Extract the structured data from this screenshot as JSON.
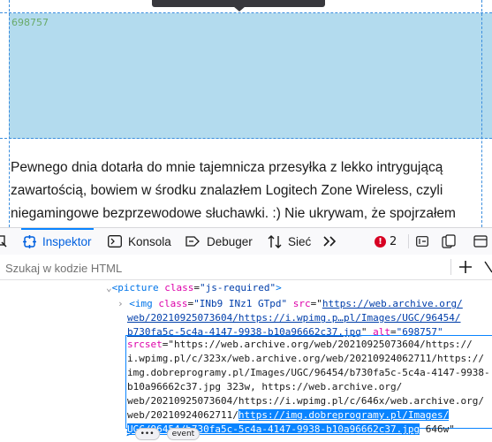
{
  "preview": {
    "image_alt": "698757",
    "article_lines": [
      "Pewnego dnia dotarła do mnie tajemnicza przesyłka z lekko intrygującą",
      "zawartością, bowiem w środku znalazłem Logitech Zone Wireless, czyli",
      "niegamingowe bezprzewodowe słuchawki. :) Nie ukrywam, że spojrzałem"
    ],
    "highlight_color": "#b3dbee"
  },
  "devtools": {
    "tabs": [
      {
        "label": "Inspektor",
        "icon": "inspector-icon",
        "active": true
      },
      {
        "label": "Konsola",
        "icon": "console-icon",
        "active": false
      },
      {
        "label": "Debuger",
        "icon": "debugger-icon",
        "active": false
      },
      {
        "label": "Sieć",
        "icon": "network-icon",
        "active": false
      }
    ],
    "error_count": "2",
    "search_placeholder": "Szukaj w kodzie HTML",
    "accent": "#0a84ff",
    "tree": {
      "picture_open": "<",
      "picture_tag": "picture",
      "picture_attr": "class",
      "picture_eq": "=",
      "picture_val": "\"js-required\"",
      "picture_close": ">",
      "img_open": "<",
      "img_tag": "img",
      "img_class_attr": "class",
      "img_class_val": "\"INb9 INz1 GTpd\"",
      "img_src_attr": "src",
      "img_src_part1": "https://web.archive.org/",
      "img_src_part2": "web/20210925073604/https://i.wpimg.p…pl/Images/UGC/96454/",
      "img_src_part3": "b730fa5c-5c4a-4147-9938-b10a96662c37.jpg",
      "img_alt_attr": "alt",
      "img_alt_val": "\"698757\"",
      "srcset_attr": "srcset",
      "srcset_lines": [
        "=\"https://web.archive.org/web/20210925073604/https://",
        "i.wpimg.pl/c/323x/web.archive.org/web/20210924062711/https://",
        "img.dobreprogramy.pl/Images/UGC/96454/b730fa5c-5c4a-4147-9938-",
        "b10a96662c37.jpg 323w, https://web.archive.org/",
        "web/20210925073604/https://i.wpimg.pl/c/646x/web.archive.org/"
      ],
      "srcset_line6_prefix": "web/20210924062711/",
      "srcset_selected_1": "https://img.dobreprogramy.pl/Images/",
      "srcset_selected_2": "UGC/96454/b730fa5c-5c4a-4147-9938-b10a96662c37.jpg",
      "srcset_suffix": " 646w\"",
      "ellipsis": "•••",
      "event_badge": "event"
    }
  }
}
